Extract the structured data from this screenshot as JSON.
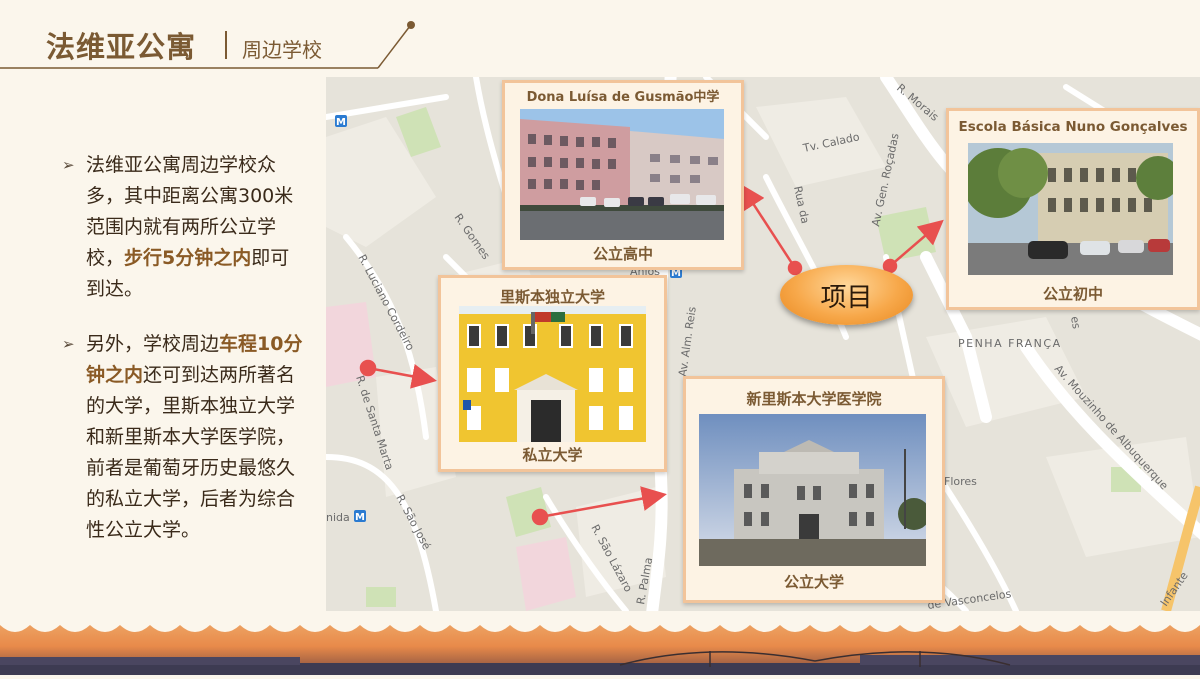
{
  "header": {
    "title": "法维亚公寓",
    "subtitle": "周边学校"
  },
  "bullets": [
    {
      "pre": "法维亚公寓周边学校众多，其中距离公寓300米范围内就有两所公立学校，",
      "highlight": "步行5分钟之内",
      "post": "即可到达。"
    },
    {
      "pre": "另外，学校周边",
      "highlight": "车程10分钟之内",
      "post": "还可到达两所著名的大学，里斯本独立大学和新里斯本大学医学院，前者是葡萄牙历史最悠久的私立大学，后者为综合性公立大学。"
    }
  ],
  "map": {
    "streets": [
      "R. Morais",
      "Tv. Calado",
      "Av. Gen. Roçadas",
      "Rua da",
      "R. Gomes",
      "R. Luciano Cordeiro",
      "R. de Santa Marta",
      "R. São José",
      "R. São Lázaro",
      "R. Palma",
      "Av. Alm. Reis",
      "PENHA FRANÇA",
      "Av. Mouzinho de Albuquerque",
      "Flores",
      "de Vasconcelos",
      "Anjos",
      "es",
      "nida",
      "Infante"
    ],
    "project_label": "项目"
  },
  "cards": {
    "high_school": {
      "title": "Dona Luísa de Gusmão中学",
      "caption": "公立高中"
    },
    "middle_school": {
      "title": "Escola Básica Nuno Gonçalves",
      "caption": "公立初中"
    },
    "private_univ": {
      "title": "里斯本独立大学",
      "caption": "私立大学"
    },
    "public_univ": {
      "title": "新里斯本大学医学院",
      "caption": "公立大学"
    }
  },
  "colors": {
    "accent": "#7b5a33",
    "card_border": "#f2c49a",
    "arrow": "#e8504f"
  }
}
